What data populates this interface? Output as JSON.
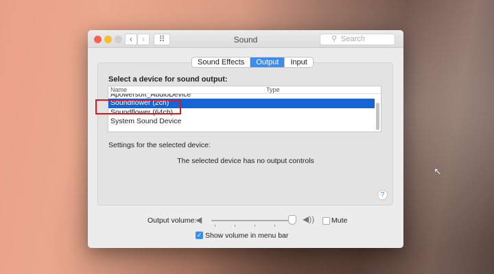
{
  "window": {
    "title": "Sound",
    "search_placeholder": "Search"
  },
  "nav": {
    "back": "‹",
    "forward": "›",
    "grid": "⠿"
  },
  "tabs": [
    {
      "label": "Sound Effects",
      "active": false
    },
    {
      "label": "Output",
      "active": true
    },
    {
      "label": "Input",
      "active": false
    }
  ],
  "output": {
    "heading": "Select a device for sound output:",
    "columns": [
      "Name",
      "Type"
    ],
    "devices": [
      {
        "name": "Apowersoft_AudioDevice",
        "type": ""
      },
      {
        "name": "Soundflower (2ch)",
        "type": "",
        "selected": true
      },
      {
        "name": "Soundflower (64ch)",
        "type": ""
      },
      {
        "name": "System Sound Device",
        "type": ""
      }
    ],
    "settings_label": "Settings for the selected device:",
    "no_controls": "The selected device has no output controls",
    "help": "?"
  },
  "volume": {
    "label": "Output volume:",
    "value": 0.97,
    "mute_label": "Mute",
    "muted": false,
    "show_in_menu_bar_label": "Show volume in menu bar",
    "show_in_menu_bar": true
  },
  "colors": {
    "accent": "#3b8ef0",
    "selection": "#1764d4",
    "highlight_box": "#e4141b"
  }
}
